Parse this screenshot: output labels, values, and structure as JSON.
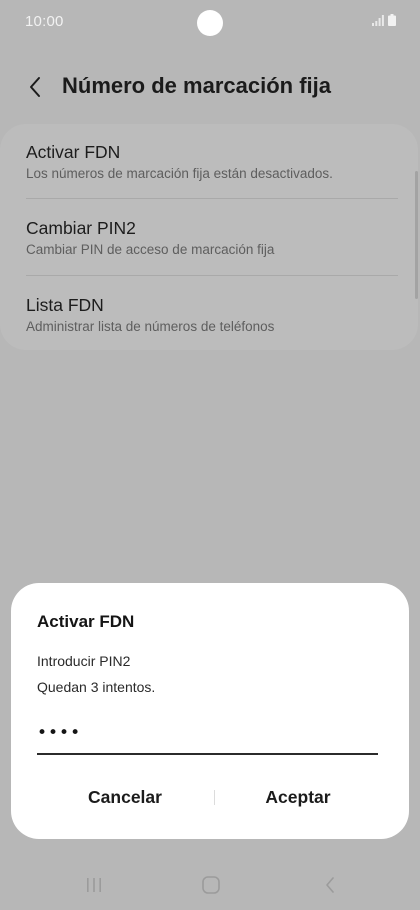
{
  "status_bar": {
    "time": "10:00"
  },
  "header": {
    "title": "Número de marcación fija",
    "back_icon": "chevron-left-icon"
  },
  "settings": {
    "items": [
      {
        "title": "Activar FDN",
        "subtitle": "Los números de marcación fija están desactivados."
      },
      {
        "title": "Cambiar PIN2",
        "subtitle": "Cambiar PIN de acceso de marcación fija"
      },
      {
        "title": "Lista FDN",
        "subtitle": "Administrar lista de números de teléfonos"
      }
    ]
  },
  "dialog": {
    "title": "Activar FDN",
    "prompt": "Introducir PIN2",
    "attempts": "Quedan 3 intentos.",
    "pin_value": "••••",
    "cancel_label": "Cancelar",
    "accept_label": "Aceptar"
  },
  "nav_bar": {
    "recents_icon": "recent-apps-icon",
    "home_icon": "home-icon",
    "back_icon": "back-icon"
  },
  "colors": {
    "scrim_background": "#b7b7b7",
    "card_background": "#bcbcbc",
    "dialog_background": "#ffffff",
    "text_primary": "#1d1d1d",
    "text_secondary": "#5e5e5e"
  }
}
